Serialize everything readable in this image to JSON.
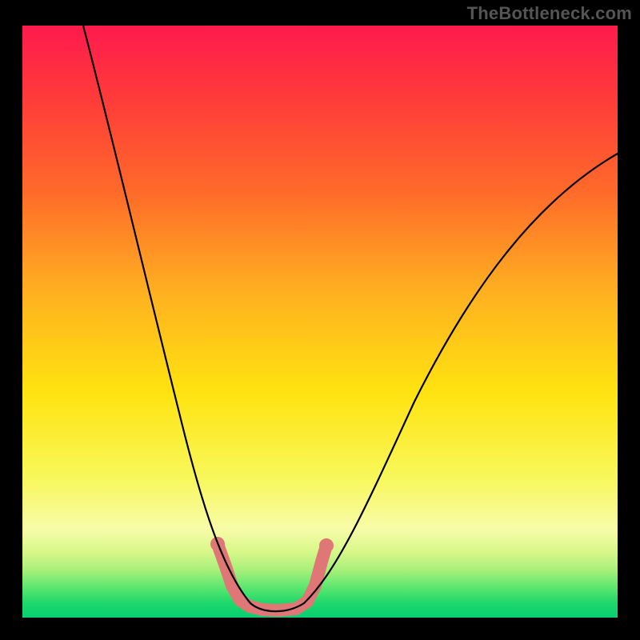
{
  "watermark": "TheBottleneck.com",
  "colors": {
    "gradient_top": "#ff1a4d",
    "gradient_mid": "#ffe310",
    "gradient_bottom": "#07cf72",
    "curve": "#000000",
    "highlight_band": "#e07777",
    "frame": "#000000"
  },
  "chart_data": {
    "type": "line",
    "title": "",
    "xlabel": "",
    "ylabel": "",
    "description": "Bottleneck valley curve over a vertical red→yellow→green gradient; trough indicates balanced / optimal range (highlighted in salmon).",
    "x_range_fraction": [
      0.0,
      1.0
    ],
    "y_range_fraction": [
      0.0,
      1.0
    ],
    "series": [
      {
        "name": "bottleneck-curve",
        "note": "x is horizontal fraction across plot; y is bottleneck severity fraction (1 = top/red/worst, 0 = bottom/green/best). Values eyeballed from gridless figure.",
        "x": [
          0.1,
          0.15,
          0.2,
          0.25,
          0.3,
          0.34,
          0.38,
          0.42,
          0.46,
          0.5,
          0.56,
          0.65,
          0.78,
          0.9,
          1.0
        ],
        "y": [
          1.0,
          0.78,
          0.58,
          0.38,
          0.2,
          0.08,
          0.02,
          0.01,
          0.02,
          0.08,
          0.2,
          0.38,
          0.58,
          0.72,
          0.79
        ]
      }
    ],
    "optimal_band_x_fraction": [
      0.33,
      0.51
    ],
    "optimal_band_y_fraction_approx": 0.03,
    "background_gradient_stops": [
      {
        "pos": 0.0,
        "color": "#ff1a4d"
      },
      {
        "pos": 0.28,
        "color": "#ff6a2a"
      },
      {
        "pos": 0.62,
        "color": "#ffe310"
      },
      {
        "pos": 0.85,
        "color": "#f8fca8"
      },
      {
        "pos": 0.95,
        "color": "#5ae66f"
      },
      {
        "pos": 1.0,
        "color": "#07cf72"
      }
    ]
  }
}
